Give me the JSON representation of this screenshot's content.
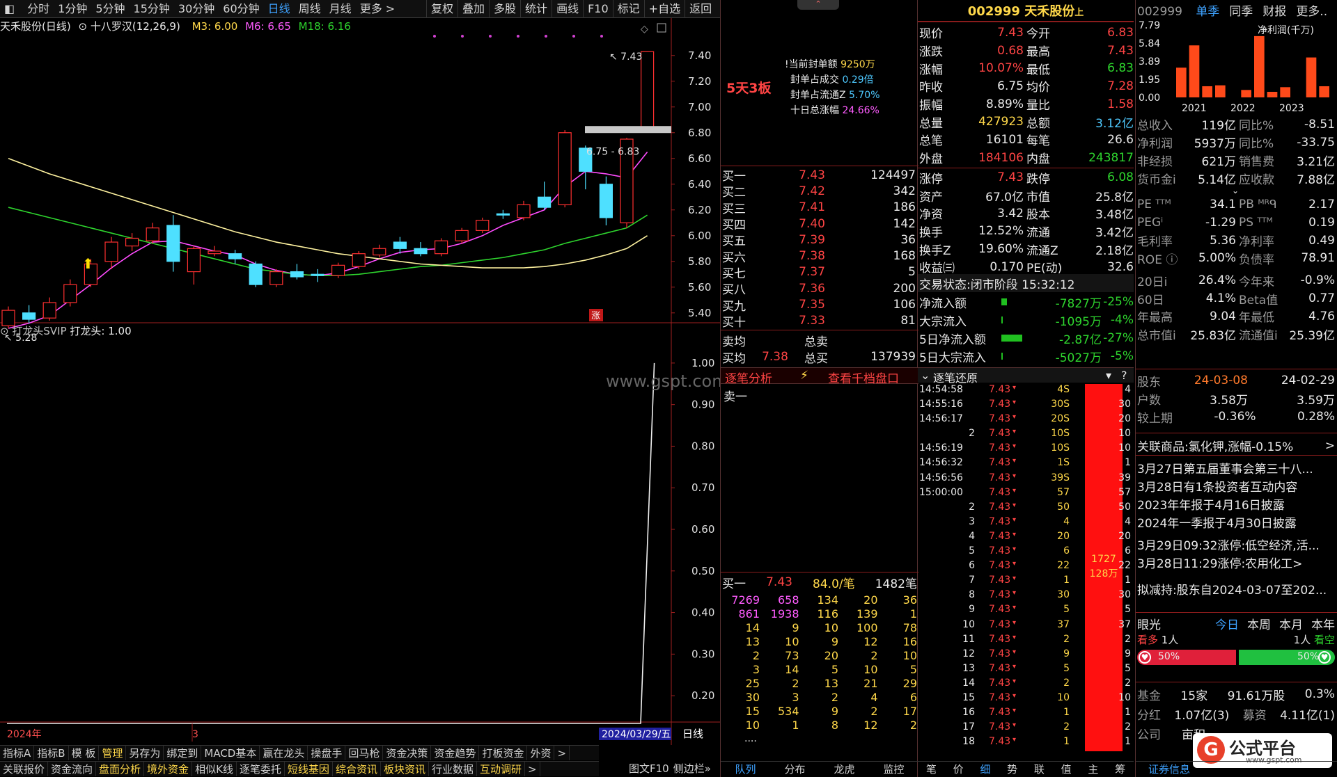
{
  "toolbar": {
    "periods": [
      "分时",
      "1分钟",
      "5分钟",
      "15分钟",
      "30分钟",
      "60分钟",
      "日线",
      "周线",
      "月线",
      "更多 >"
    ],
    "active_period": "日线",
    "actions": [
      "复权",
      "叠加",
      "多股",
      "统计",
      "画线",
      "F10",
      "标记",
      "+自选",
      "返回"
    ]
  },
  "chart": {
    "stock_label": "天禾股份(日线)",
    "indicator_name": "十八罗汉(12,26,9)",
    "m3": "M3: 6.00",
    "m6": "M6: 6.65",
    "m18": "M18: 6.16",
    "high_label": "7.43",
    "low_label": "5.28",
    "range_label": "6.75 - 6.83",
    "zhang_badge": "涨",
    "y_ticks": [
      "7.40",
      "7.20",
      "7.00",
      "6.80",
      "6.60",
      "6.40",
      "6.20",
      "6.00",
      "5.80",
      "5.60",
      "5.40"
    ],
    "ind_ticks": [
      "1.00",
      "0.90",
      "0.80",
      "0.70",
      "0.60",
      "0.50",
      "0.40",
      "0.30",
      "0.20"
    ],
    "watermark": "www.gspt.com",
    "year_label": "2024年",
    "month_label": "3",
    "date_label": "2024/03/29/五",
    "period_label": "日线",
    "zoom_in": "+",
    "zoom_out": "−"
  },
  "chart_data": {
    "type": "candlestick",
    "candles": [
      {
        "o": 5.3,
        "c": 5.42,
        "h": 5.45,
        "l": 5.28
      },
      {
        "o": 5.4,
        "c": 5.35,
        "h": 5.46,
        "l": 5.32
      },
      {
        "o": 5.36,
        "c": 5.48,
        "h": 5.52,
        "l": 5.34
      },
      {
        "o": 5.48,
        "c": 5.62,
        "h": 5.66,
        "l": 5.45
      },
      {
        "o": 5.62,
        "c": 5.78,
        "h": 5.82,
        "l": 5.6
      },
      {
        "o": 5.8,
        "c": 5.95,
        "h": 5.99,
        "l": 5.74
      },
      {
        "o": 5.92,
        "c": 5.98,
        "h": 6.02,
        "l": 5.88
      },
      {
        "o": 5.96,
        "c": 6.06,
        "h": 6.1,
        "l": 5.94
      },
      {
        "o": 6.08,
        "c": 5.8,
        "h": 6.16,
        "l": 5.72
      },
      {
        "o": 5.72,
        "c": 5.9,
        "h": 5.92,
        "l": 5.62
      },
      {
        "o": 5.86,
        "c": 5.88,
        "h": 5.92,
        "l": 5.84
      },
      {
        "o": 5.86,
        "c": 5.82,
        "h": 5.89,
        "l": 5.78
      },
      {
        "o": 5.78,
        "c": 5.62,
        "h": 5.8,
        "l": 5.6
      },
      {
        "o": 5.62,
        "c": 5.72,
        "h": 5.74,
        "l": 5.6
      },
      {
        "o": 5.72,
        "c": 5.68,
        "h": 5.78,
        "l": 5.66
      },
      {
        "o": 5.7,
        "c": 5.69,
        "h": 5.74,
        "l": 5.64
      },
      {
        "o": 5.69,
        "c": 5.77,
        "h": 5.79,
        "l": 5.67
      },
      {
        "o": 5.76,
        "c": 5.86,
        "h": 5.88,
        "l": 5.74
      },
      {
        "o": 5.85,
        "c": 5.9,
        "h": 5.93,
        "l": 5.83
      },
      {
        "o": 5.95,
        "c": 5.9,
        "h": 5.99,
        "l": 5.86
      },
      {
        "o": 5.9,
        "c": 5.86,
        "h": 5.95,
        "l": 5.84
      },
      {
        "o": 5.86,
        "c": 5.96,
        "h": 5.98,
        "l": 5.84
      },
      {
        "o": 5.96,
        "c": 6.04,
        "h": 6.06,
        "l": 5.94
      },
      {
        "o": 6.04,
        "c": 6.12,
        "h": 6.14,
        "l": 6.02
      },
      {
        "o": 6.17,
        "c": 6.16,
        "h": 6.2,
        "l": 6.13
      },
      {
        "o": 6.14,
        "c": 6.24,
        "h": 6.27,
        "l": 6.12
      },
      {
        "o": 6.3,
        "c": 6.22,
        "h": 6.42,
        "l": 6.2
      },
      {
        "o": 6.24,
        "c": 6.8,
        "h": 6.82,
        "l": 6.22
      },
      {
        "o": 6.68,
        "c": 6.5,
        "h": 6.7,
        "l": 6.36
      },
      {
        "o": 6.4,
        "c": 6.14,
        "h": 6.46,
        "l": 6.08
      },
      {
        "o": 6.1,
        "c": 6.75,
        "h": 6.76,
        "l": 6.06
      },
      {
        "o": 6.83,
        "c": 7.43,
        "h": 7.43,
        "l": 6.83
      }
    ],
    "ma": [
      {
        "name": "M3",
        "color": "#ff4cff",
        "values": [
          5.28,
          5.32,
          5.38,
          5.5,
          5.62,
          5.75,
          5.86,
          5.95,
          5.96,
          5.92,
          5.88,
          5.85,
          5.78,
          5.73,
          5.7,
          5.69,
          5.71,
          5.76,
          5.82,
          5.87,
          5.89,
          5.9,
          5.94,
          6.0,
          6.08,
          6.14,
          6.2,
          6.38,
          6.5,
          6.48,
          6.45,
          6.65
        ]
      },
      {
        "name": "M18",
        "color": "#2ed52e",
        "values": [
          6.22,
          6.18,
          6.14,
          6.1,
          6.06,
          6.02,
          5.98,
          5.94,
          5.9,
          5.86,
          5.82,
          5.78,
          5.74,
          5.72,
          5.7,
          5.69,
          5.69,
          5.7,
          5.72,
          5.74,
          5.76,
          5.77,
          5.79,
          5.81,
          5.83,
          5.86,
          5.89,
          5.94,
          5.98,
          6.02,
          6.06,
          6.16
        ]
      },
      {
        "name": "Y",
        "color": "#fff3a0",
        "values": [
          6.6,
          6.54,
          6.48,
          6.43,
          6.38,
          6.33,
          6.28,
          6.23,
          6.18,
          6.13,
          6.08,
          6.03,
          5.99,
          5.95,
          5.92,
          5.89,
          5.86,
          5.84,
          5.82,
          5.8,
          5.78,
          5.77,
          5.76,
          5.75,
          5.75,
          5.75,
          5.76,
          5.78,
          5.81,
          5.85,
          5.9,
          6.0
        ]
      }
    ],
    "ylim": [
      5.28,
      7.55
    ],
    "indicator": {
      "name": "打龙头",
      "values": [
        0,
        0,
        0,
        0,
        0,
        0,
        0,
        0,
        0,
        0,
        0,
        0,
        0,
        0,
        0,
        0,
        0,
        0,
        0,
        0,
        0,
        0,
        0,
        0,
        0,
        0,
        0,
        0,
        0,
        0,
        0,
        1.0
      ],
      "ylim": [
        0.15,
        1.05
      ]
    }
  },
  "dragon_panel": {
    "headline": "5天3板",
    "seal_amount_label": "当前封单额",
    "seal_amount": "9250万",
    "seal_vol_label": "封单占成交",
    "seal_vol": "0.29倍",
    "seal_float_label": "封单占流通Z",
    "seal_float": "5.70%",
    "ten_day_label": "十日总涨幅",
    "ten_day": "24.66%"
  },
  "bids": [
    {
      "name": "买一",
      "price": "7.43",
      "vol": "124497"
    },
    {
      "name": "买二",
      "price": "7.42",
      "vol": "342"
    },
    {
      "name": "买三",
      "price": "7.41",
      "vol": "186"
    },
    {
      "name": "买四",
      "price": "7.40",
      "vol": "142"
    },
    {
      "name": "买五",
      "price": "7.39",
      "vol": "36"
    },
    {
      "name": "买六",
      "price": "7.38",
      "vol": "168"
    },
    {
      "name": "买七",
      "price": "7.37",
      "vol": "5"
    },
    {
      "name": "买八",
      "price": "7.36",
      "vol": "200"
    },
    {
      "name": "买九",
      "price": "7.35",
      "vol": "106"
    },
    {
      "name": "买十",
      "price": "7.33",
      "vol": "81"
    }
  ],
  "avg": {
    "sell_avg_label": "卖均",
    "sell_total_label": "总卖",
    "buy_avg_label": "买均",
    "buy_avg": "7.38",
    "buy_total_label": "总买",
    "buy_total": "137939"
  },
  "order_analysis": {
    "tab1": "逐笔分析",
    "tab2": "查看千档盘口",
    "sell1": "卖一"
  },
  "queue": {
    "label": "买一",
    "price": "7.43",
    "per": "84.0/笔",
    "count": "1482笔",
    "rows": [
      [
        "7269",
        "658",
        "134",
        "20",
        "36"
      ],
      [
        "861",
        "1938",
        "116",
        "139",
        "1"
      ],
      [
        "14",
        "9",
        "10",
        "100",
        "78"
      ],
      [
        "13",
        "10",
        "9",
        "12",
        "16"
      ],
      [
        "2",
        "73",
        "20",
        "2",
        "10"
      ],
      [
        "3",
        "14",
        "5",
        "10",
        "5"
      ],
      [
        "25",
        "2",
        "13",
        "21",
        "29"
      ],
      [
        "30",
        "3",
        "2",
        "4",
        "6"
      ],
      [
        "15",
        "534",
        "9",
        "2",
        "17"
      ],
      [
        "10",
        "1",
        "8",
        "12",
        "2"
      ]
    ],
    "more": "...."
  },
  "quote": {
    "code_name": "002999 天禾股份",
    "suffix": "上",
    "rows": [
      [
        "现价",
        "7.43",
        "今开",
        "6.83"
      ],
      [
        "涨跌",
        "0.68",
        "最高",
        "7.43"
      ],
      [
        "涨幅",
        "10.07%",
        "最低",
        "6.83"
      ],
      [
        "昨收",
        "6.75",
        "均价",
        "7.28"
      ],
      [
        "振幅",
        "8.89%",
        "量比",
        "1.58"
      ],
      [
        "总量",
        "427923",
        "总额",
        "3.12亿"
      ],
      [
        "总笔",
        "16101",
        "每笔",
        "26.6"
      ],
      [
        "外盘",
        "184106",
        "内盘",
        "243817"
      ],
      [
        "涨停",
        "7.43",
        "跌停",
        "6.08"
      ],
      [
        "资产",
        "67.0亿",
        "市值",
        "25.8亿"
      ],
      [
        "净资",
        "3.42",
        "股本",
        "3.48亿"
      ],
      [
        "换手",
        "12.52%",
        "流通",
        "3.42亿"
      ],
      [
        "换手Z",
        "19.60%",
        "流通Z",
        "2.18亿"
      ],
      [
        "收益㈢",
        "0.170",
        "PE(动)",
        "32.6"
      ]
    ],
    "status_label": "交易状态:",
    "status": "闭市阶段",
    "status_time": "15:32:12",
    "flows": [
      [
        "净流入额",
        "-7827万",
        "-25%"
      ],
      [
        "大宗流入",
        "-1095万",
        "-4%"
      ],
      [
        "5日净流入额",
        "-2.87亿",
        "-27%"
      ],
      [
        "5日大宗流入",
        "-5027万",
        "-5%"
      ]
    ]
  },
  "ticks": {
    "title": "逐笔还原",
    "rows": [
      [
        "14:54:58",
        "7.43",
        "4S",
        "4"
      ],
      [
        "14:55:16",
        "7.43",
        "30S",
        "30"
      ],
      [
        "14:56:17",
        "7.43",
        "20S",
        "20"
      ],
      [
        "2",
        "7.43",
        "10S",
        "10"
      ],
      [
        "14:56:19",
        "7.43",
        "10S",
        "10"
      ],
      [
        "14:56:32",
        "7.43",
        "1S",
        "1"
      ],
      [
        "14:56:56",
        "7.43",
        "39S",
        "39"
      ],
      [
        "15:00:00",
        "7.43",
        "57",
        "57"
      ],
      [
        "2",
        "7.43",
        "50",
        "50"
      ],
      [
        "3",
        "7.43",
        "4",
        "4"
      ],
      [
        "4",
        "7.43",
        "20",
        "20"
      ],
      [
        "5",
        "7.43",
        "6",
        "6"
      ],
      [
        "6",
        "7.43",
        "22",
        "22"
      ],
      [
        "7",
        "7.43",
        "1",
        "1"
      ],
      [
        "8",
        "7.43",
        "30",
        "30"
      ],
      [
        "9",
        "7.43",
        "5",
        "5"
      ],
      [
        "10",
        "7.43",
        "37",
        "37"
      ],
      [
        "11",
        "7.43",
        "2",
        "2"
      ],
      [
        "12",
        "7.43",
        "9",
        "9"
      ],
      [
        "13",
        "7.43",
        "5",
        "5"
      ],
      [
        "14",
        "7.43",
        "2",
        "2"
      ],
      [
        "15",
        "7.43",
        "10",
        "10"
      ],
      [
        "16",
        "7.43",
        "1",
        "1"
      ],
      [
        "17",
        "7.43",
        "2",
        "2"
      ],
      [
        "18",
        "7.43",
        "1",
        "1"
      ]
    ],
    "bar_top": "1727",
    "bar_bottom": "128万"
  },
  "fin": {
    "code": "002999",
    "tabs": [
      "单季",
      "同季",
      "财报",
      "更多.."
    ],
    "chart_title": "净利润(千万)",
    "yticks": [
      "7.79",
      "5.84",
      "3.89",
      "1.95",
      "0.00"
    ],
    "years": [
      "2021",
      "2022",
      "2023"
    ],
    "bars": [
      3.2,
      5.6,
      1.2,
      1.3,
      0,
      0.8,
      6.6,
      0.6,
      1.1,
      0,
      4.3,
      1.2
    ],
    "rows": [
      [
        "总收入",
        "119亿",
        "同比%",
        "-8.51"
      ],
      [
        "净利润",
        "5937万",
        "同比%",
        "-33.75"
      ],
      [
        "非经损",
        "621万",
        "销售费",
        "3.21亿"
      ],
      [
        "货币金i",
        "5.14亿",
        "应收款",
        "7.88亿"
      ],
      [
        "PE ᵀᵀᴹ",
        "34.1",
        "PB ᴹᴿᑫ",
        "2.17"
      ],
      [
        "PEGⁱ",
        "-1.29",
        "PS ᵀᵀᴹ",
        "0.19"
      ],
      [
        "毛利率",
        "5.36",
        "净利率",
        "0.49"
      ],
      [
        "ROE ⓘ",
        "5.00%",
        "负债率",
        "78.91"
      ],
      [
        "20日i",
        "26.4%",
        "今年来",
        "-0.9%"
      ],
      [
        "60日",
        "4.1%",
        "Beta值",
        "0.77"
      ],
      [
        "年最高",
        "9.04",
        "年最低",
        "4.76"
      ],
      [
        "总市值i",
        "25.83亿",
        "流通值i",
        "25.39亿"
      ]
    ],
    "holders_label": "股东",
    "h_date1": "24-03-08",
    "h_date2": "24-02-29",
    "holders": [
      [
        "户数",
        "3.58万",
        "3.59万"
      ],
      [
        "较上期",
        "-0.36%",
        "0.28%"
      ]
    ],
    "related": "关联商品:氯化钾,涨幅-0.15%",
    "news": [
      "3月27日第五届董事会第三十八...",
      "3月28日有1条投资者互动内容",
      "2023年年报于4月16日披露",
      "2024年一季报于4月30日披露",
      "3月29日09:32涨停:低空经济,活...",
      "3月28日11:29涨停:农用化工>",
      "拟减持:股东自2024-03-07至202..."
    ],
    "eye_label": "眼光",
    "eye_tabs": [
      "今日",
      "本周",
      "本月",
      "本年"
    ],
    "bull_label": "看多",
    "bull_count": "1人",
    "bear_count": "1人",
    "bear_label": "看空",
    "bull_pct": "50%",
    "bear_pct": "50%",
    "fund_label": "基金",
    "fund_count": "15家",
    "fund_shares": "91.61万股",
    "fund_pct": "0.3%",
    "div_label": "分红",
    "div_val": "1.07亿(3)",
    "raise_label": "募资",
    "raise_val": "4.11亿(1)",
    "corp_label": "公司",
    "corp_val": "亩积"
  },
  "bottom_tabs1": [
    "指标A",
    "指标B",
    "模 板",
    "管理",
    "另存为",
    "绑定到",
    "MACD基本",
    "赢在龙头",
    "操盘手",
    "回马枪",
    "资金决策",
    "资金趋势",
    "打板资金",
    "外资",
    ">"
  ],
  "bottom_tabs2": [
    "关联报价",
    "资金流向",
    "盘面分析",
    "境外资金",
    "相似K线",
    "逐笔委托",
    "短线基因",
    "综合资讯",
    "板块资讯",
    "行业数据",
    "互动调研",
    ">"
  ],
  "bottom_mid": [
    "图文F10",
    "侧边栏»"
  ],
  "bottom_tabs3": [
    "队列",
    "分布",
    "龙虎",
    "监控"
  ],
  "bottom_tabs4": [
    "笔",
    "价",
    "细",
    "势",
    "联",
    "值",
    "主",
    "筹"
  ],
  "bottom_right": "证券信息",
  "logo": {
    "text": "公式平台",
    "url": "www.gspt.com"
  }
}
